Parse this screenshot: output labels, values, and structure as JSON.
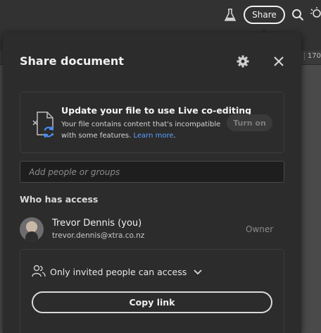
{
  "toolbar": {
    "share_label": "Share",
    "ruler_label": "170"
  },
  "panel": {
    "title": "Share document",
    "notice": {
      "title": "Update your file to use Live co-editing",
      "body": "Your file contains content that's incompatible with some features.",
      "learn_more": "Learn more",
      "turn_on_label": "Turn on"
    },
    "add_people_placeholder": "Add people or groups",
    "who_has_access_title": "Who has access",
    "user": {
      "name": "Trevor Dennis (you)",
      "email": "trevor.dennis@xtra.co.nz",
      "role": "Owner"
    },
    "access_setting": "Only invited people can access",
    "copy_link_label": "Copy link"
  },
  "colors": {
    "panel_bg": "#2c2c2c",
    "app_bg": "#323232",
    "link": "#5aa0ff"
  }
}
